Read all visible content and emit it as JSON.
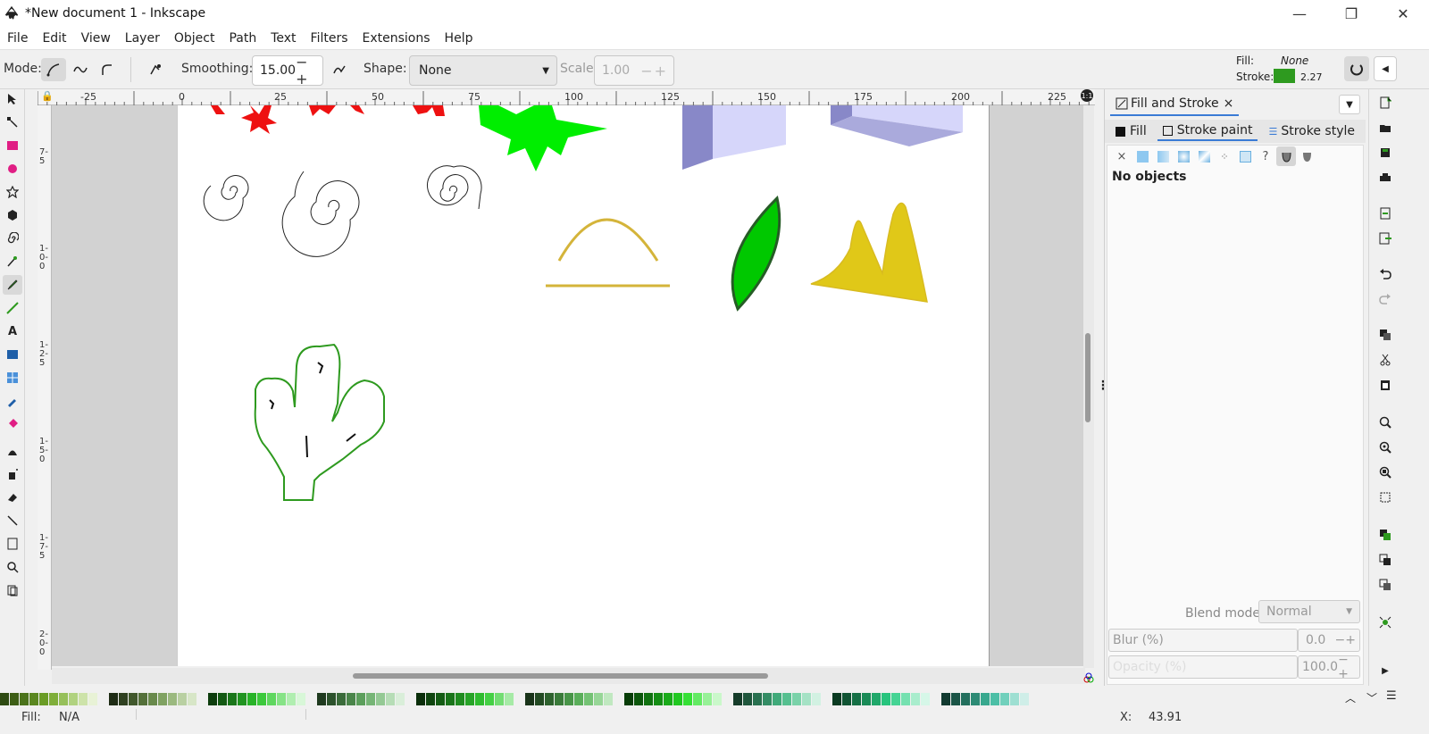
{
  "window": {
    "title": "*New document 1 - Inkscape",
    "minimize": "—",
    "restore": "❐",
    "close": "✕"
  },
  "menubar": [
    "File",
    "Edit",
    "View",
    "Layer",
    "Object",
    "Path",
    "Text",
    "Filters",
    "Extensions",
    "Help"
  ],
  "toolcontrols": {
    "mode_label": "Mode:",
    "smoothing_label": "Smoothing:",
    "smoothing_value": "15.00",
    "shape_label": "Shape:",
    "shape_value": "None",
    "scale_label": "Scale:",
    "scale_value": "1.00"
  },
  "fill_stroke_indicator": {
    "fill_label": "Fill:",
    "fill_value": "None",
    "stroke_label": "Stroke:",
    "stroke_color": "#2e9a1f",
    "stroke_width": "2.27"
  },
  "ruler": {
    "h_ticks": [
      "-25",
      "0",
      "25",
      "50",
      "75",
      "100",
      "125",
      "150",
      "175",
      "200",
      "225"
    ],
    "v_ticks": [
      "7-5",
      "1-0-0",
      "1-2-5",
      "1-5-0",
      "1-7-5",
      "2-0-0"
    ]
  },
  "dock": {
    "tab_title": "Fill and Stroke",
    "tab_close": "×",
    "subtabs": [
      "Fill",
      "Stroke paint",
      "Stroke style"
    ],
    "paint_none_icon": "×",
    "paint_unknown_icon": "?",
    "no_objects": "No objects",
    "blend_label": "Blend mode:",
    "blend_value": "Normal",
    "blur_label": "Blur (%)",
    "blur_value": "0.0",
    "opacity_label": "Opacity (%)",
    "opacity_value": "100.0"
  },
  "colors": {
    "accent": "#3a7bd5",
    "palette": [
      "#2e4a12",
      "#3d5e16",
      "#4b731b",
      "#5a8720",
      "#6a9c26",
      "#7fae3a",
      "#96c05a",
      "#b0d27f",
      "#cde3a9",
      "#e8f2d6",
      "#1e2b14",
      "#2f4020",
      "#41582c",
      "#54703a",
      "#698a4c",
      "#80a262",
      "#9bb97f",
      "#b9d0a2",
      "#d7e6c7",
      "#0d3d0d",
      "#135913",
      "#1a761a",
      "#219421",
      "#28b328",
      "#3cc93c",
      "#5fd75f",
      "#86e386",
      "#b0eeb0",
      "#d8f7d8",
      "#1f3a1f",
      "#2c522c",
      "#3a6b3a",
      "#4a854a",
      "#5c9f5c",
      "#76b576",
      "#94c994",
      "#b6ddb6",
      "#d9eed9",
      "#0a2e0a",
      "#0f450f",
      "#145c14",
      "#1a741a",
      "#208c20",
      "#27a427",
      "#2fbc2f",
      "#44d044",
      "#72dd72",
      "#a6eaa6",
      "#193319",
      "#234a23",
      "#2e622e",
      "#3a7b3a",
      "#489548",
      "#5aae5a",
      "#74c274",
      "#97d697",
      "#c0e8c0",
      "#083d08",
      "#0c570c",
      "#117211",
      "#158e15",
      "#1aab1a",
      "#20c820",
      "#35e035",
      "#63ea63",
      "#97f197",
      "#caf8ca",
      "#163c2a",
      "#1f563c",
      "#297150",
      "#348d65",
      "#40aa7a",
      "#56c090",
      "#7ad2a9",
      "#a5e2c5",
      "#d2f1e2",
      "#0b3b22",
      "#105433",
      "#156f45",
      "#1a8b57",
      "#20a86a",
      "#27c47d",
      "#45d494",
      "#75e1b0",
      "#a9edcd",
      "#d6f7e8",
      "#123a30",
      "#1a5446",
      "#236f5d",
      "#2d8b75",
      "#38a88e",
      "#4cbfa6",
      "#71d0bc",
      "#9edfd2",
      "#cfeee8"
    ]
  },
  "status": {
    "fill_label": "Fill:",
    "fill_value": "N/A",
    "x_label": "X:",
    "x_value": "43.91"
  }
}
